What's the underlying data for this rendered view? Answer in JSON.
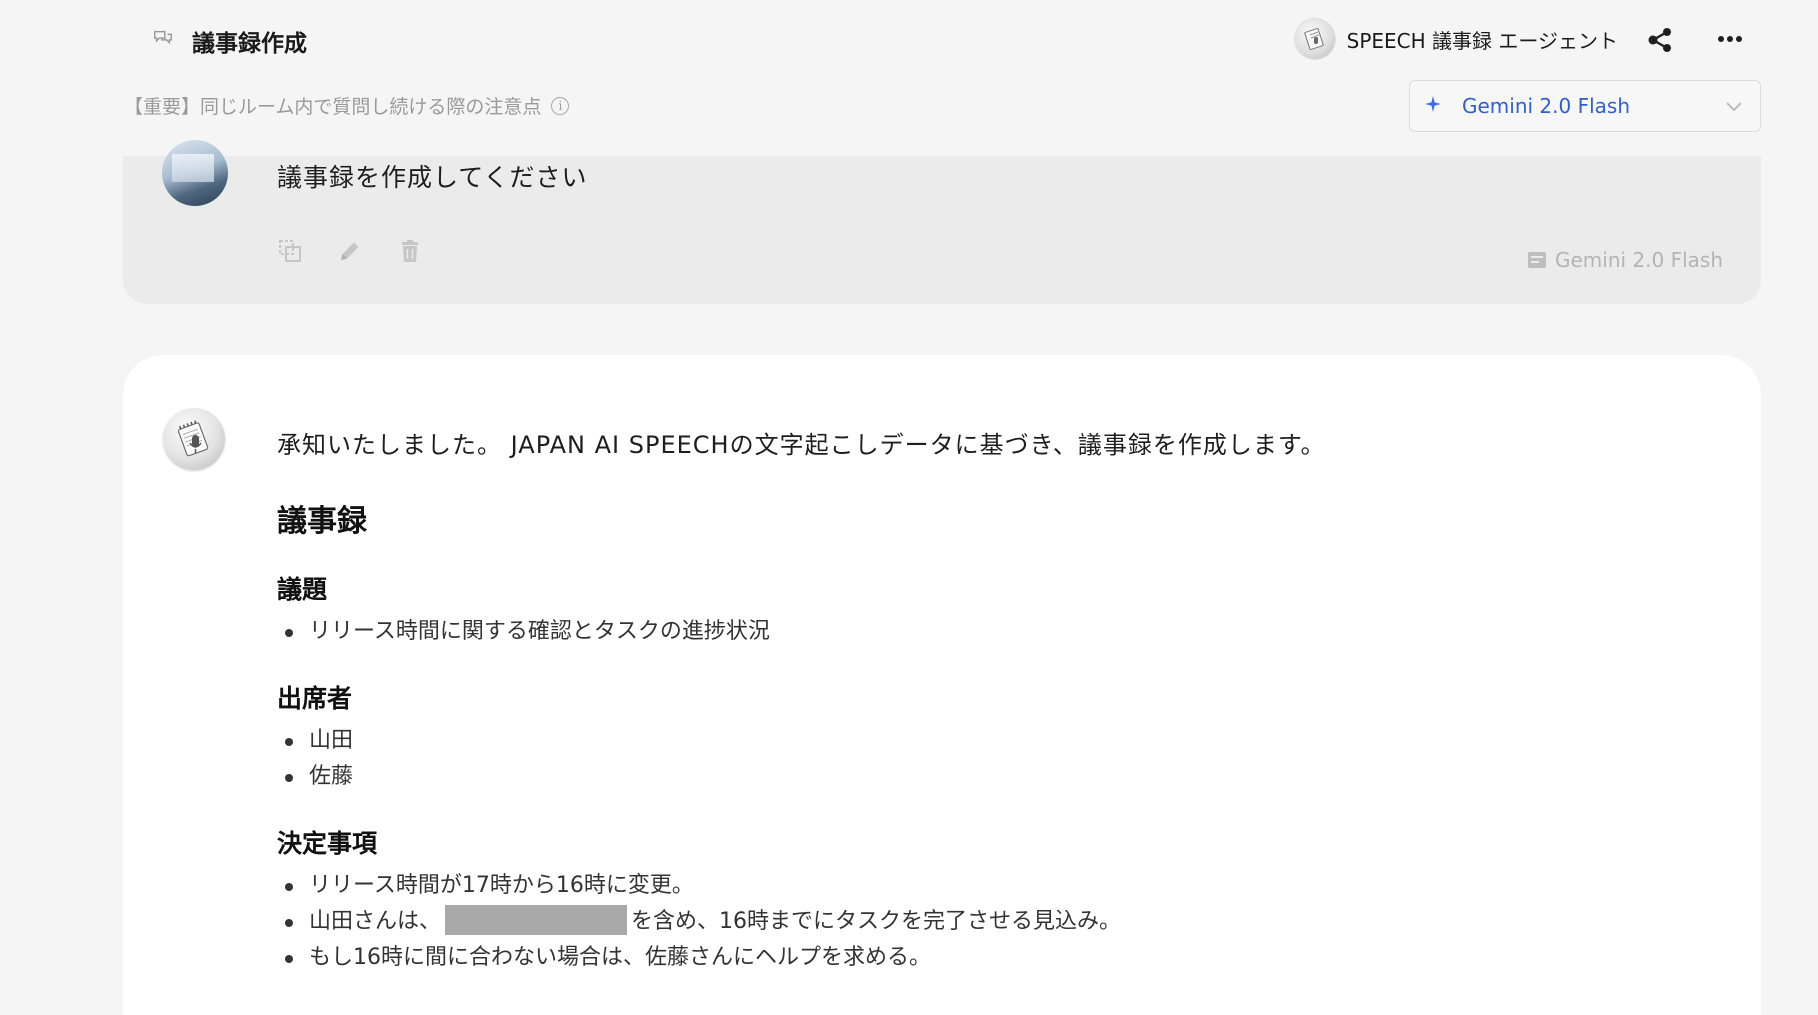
{
  "header": {
    "room_title": "議事録作成",
    "agent_name": "SPEECH 議事録 エージェント",
    "notice": "【重要】同じルーム内で質問し続ける際の注意点",
    "info_glyph": "i"
  },
  "model_select": {
    "selected": "Gemini 2.0 Flash",
    "accent": "#3b6cf0"
  },
  "user_message": {
    "text": "議事録を作成してください",
    "model": "Gemini 2.0 Flash"
  },
  "assistant_message": {
    "intro": "承知いたしました。 JAPAN AI SPEECHの文字起こしデータに基づき、議事録を作成します。",
    "heading": "議事録",
    "sections": [
      {
        "title": "議題",
        "items": [
          "リリース時間に関する確認とタスクの進捗状況"
        ]
      },
      {
        "title": "出席者",
        "items": [
          "山田",
          "佐藤"
        ]
      },
      {
        "title": "決定事項",
        "items": [
          "リリース時間が17時から16時に変更。",
          "山田さんは、",
          "を含め、16時までにタスクを完了させる見込み。",
          "もし16時に間に合わない場合は、佐藤さんにヘルプを求める。"
        ]
      }
    ]
  },
  "icons": {
    "room": "chat-bubbles-icon",
    "share": "share-icon",
    "more": "more-dots-icon",
    "model": "sparkle-icon",
    "dropdown": "chevron-down-icon",
    "copy": "copy-icon",
    "edit": "pencil-icon",
    "delete": "trash-icon"
  }
}
